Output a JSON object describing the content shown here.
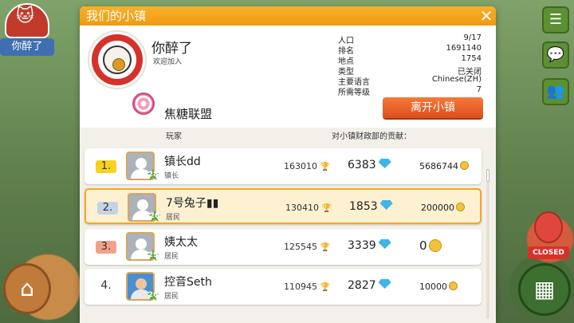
{
  "player": {
    "town_tag": "你醉了"
  },
  "dialog": {
    "title": "我们的小镇",
    "town_name": "你醉了",
    "welcome": "欢迎加入",
    "alliance_name": "焦糖联盟",
    "leave_label": "离开小镇",
    "stats": [
      {
        "key": "人口",
        "value": "9/17"
      },
      {
        "key": "排名",
        "value": "1691140"
      },
      {
        "key": "地点",
        "value": "1754"
      },
      {
        "key": "类型",
        "value": "已关闭"
      },
      {
        "key": "主要语言",
        "value": "Chinese(ZH)"
      },
      {
        "key": "所需等级",
        "value": "7"
      }
    ],
    "columns": {
      "player": "玩家",
      "contribution": "对小镇财政部的贡献："
    }
  },
  "members": [
    {
      "rank": "1.",
      "name": "镇长dd",
      "role": "镇长",
      "level": "28",
      "trophies": "163010",
      "gems": "6383",
      "coins": "5686744",
      "rank_color": "#f7d21c",
      "highlight": false,
      "photo": false
    },
    {
      "rank": "2.",
      "name": "7号兔子▮▮",
      "role": "居民",
      "level": "26",
      "trophies": "130410",
      "gems": "1853",
      "coins": "200000",
      "rank_color": "#c6d3e2",
      "highlight": true,
      "photo": false
    },
    {
      "rank": "3.",
      "name": "姨太太",
      "role": "居民",
      "level": "29",
      "trophies": "125545",
      "gems": "3339",
      "coins": "0",
      "rank_color": "#f2a28a",
      "highlight": false,
      "photo": false
    },
    {
      "rank": "4.",
      "name": "控音Seth",
      "role": "居民",
      "level": "26",
      "trophies": "110945",
      "gems": "2827",
      "coins": "10000",
      "rank_color": "",
      "highlight": false,
      "photo": true
    }
  ],
  "side_icons": [
    "menu-icon",
    "chat-icon",
    "friends-icon"
  ],
  "closed_sign_label": "CLOSED"
}
